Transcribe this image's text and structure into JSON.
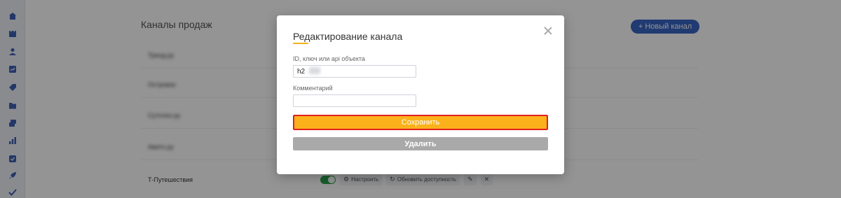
{
  "sidebar": {
    "icons": [
      "home-icon",
      "calendar-icon",
      "user-icon",
      "chart-icon",
      "tag-icon",
      "folder-icon",
      "layers-icon",
      "bar-chart-icon",
      "checkbox-icon",
      "rocket-icon",
      "check-icon"
    ]
  },
  "page": {
    "title": "Каналы продаж",
    "new_channel_button": "+ Новый канал",
    "rows": [
      {
        "name": "Тренд.ру"
      },
      {
        "name": "Островок"
      },
      {
        "name": "Суточно.ру"
      },
      {
        "name": "Авито.ру"
      },
      {
        "name": "Т-Путешествия",
        "toggle_on": true,
        "configure_label": "Настроить",
        "update_label": "Обновить доступность"
      }
    ]
  },
  "modal": {
    "title": "Редактирование канала",
    "id_label": "ID, ключ или api объекта",
    "id_value": "h2",
    "comment_label": "Комментарий",
    "comment_value": "",
    "save_button": "Сохранить",
    "delete_button": "Удалить"
  },
  "colors": {
    "accent": "#fbb21a",
    "primary": "#3764c4",
    "highlight_border": "#e02020",
    "toggle_on": "#2aa14a",
    "delete": "#a9a9a9"
  }
}
